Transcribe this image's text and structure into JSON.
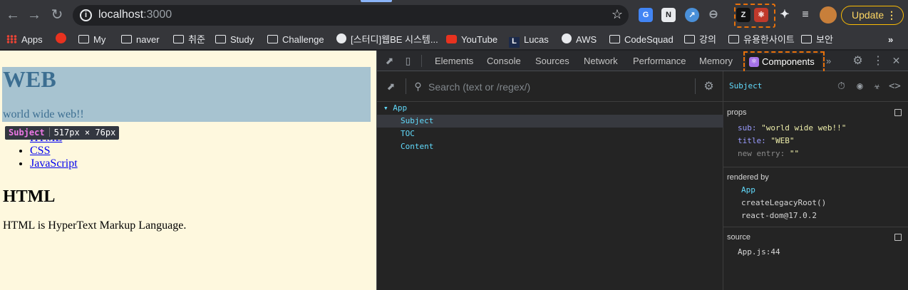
{
  "browser": {
    "url_host": "localhost",
    "url_port": ":3000",
    "update_label": "Update",
    "extensions": [
      "G",
      "N",
      "↗",
      "⊖",
      "Z",
      "⚛",
      "✦",
      "≡"
    ]
  },
  "bookmarks": [
    {
      "label": "Apps",
      "icon": "apps-icon"
    },
    {
      "label": "",
      "icon": "youtube-red-icon"
    },
    {
      "label": "My",
      "icon": "folder-icon"
    },
    {
      "label": "naver",
      "icon": "folder-icon"
    },
    {
      "label": "취준",
      "icon": "folder-icon"
    },
    {
      "label": "Study",
      "icon": "folder-icon"
    },
    {
      "label": "Challenge",
      "icon": "folder-icon"
    },
    {
      "label": "[스터디]웹BE 시스템...",
      "icon": "globe-icon"
    },
    {
      "label": "YouTube",
      "icon": "youtube-icon"
    },
    {
      "label": "Lucas",
      "icon": "l-icon"
    },
    {
      "label": "AWS",
      "icon": "globe-icon"
    },
    {
      "label": "CodeSquad",
      "icon": "folder-icon"
    },
    {
      "label": "강의",
      "icon": "folder-icon"
    },
    {
      "label": "유용한사이트",
      "icon": "folder-icon"
    },
    {
      "label": "보안",
      "icon": "folder-icon"
    }
  ],
  "page": {
    "heading": "WEB",
    "subtitle": "world wide web!!",
    "tooltip_name": "Subject",
    "tooltip_size": "517px × 76px",
    "toc": [
      "HTML",
      "CSS",
      "JavaScript"
    ],
    "section_heading": "HTML",
    "description": "HTML is HyperText Markup Language."
  },
  "devtools": {
    "tabs": [
      "Elements",
      "Console",
      "Sources",
      "Network",
      "Performance",
      "Memory"
    ],
    "active_tab": "Components",
    "search_placeholder": "Search (text or /regex/)",
    "tree": [
      {
        "label": "▾ App",
        "selected": false
      },
      {
        "label": "Subject",
        "selected": true
      },
      {
        "label": "TOC",
        "selected": false
      },
      {
        "label": "Content",
        "selected": false
      }
    ],
    "selected_component": "Subject",
    "props_label": "props",
    "props": [
      {
        "key": "sub",
        "value": "\"world wide web!!\"",
        "dim": false
      },
      {
        "key": "title",
        "value": "\"WEB\"",
        "dim": false
      },
      {
        "key": "new entry",
        "value": "\"\"",
        "dim": true
      }
    ],
    "rendered_by_label": "rendered by",
    "rendered_by": [
      "App",
      "createLegacyRoot()",
      "react-dom@17.0.2"
    ],
    "source_label": "source",
    "source": "App.js:44"
  }
}
